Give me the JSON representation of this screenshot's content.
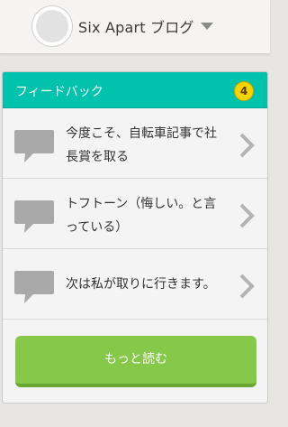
{
  "header": {
    "blog_name": "Six Apart ブログ"
  },
  "feedback": {
    "title": "フィードバック",
    "count": "4",
    "items": [
      {
        "text": "今度こそ、自転車記事で社長賞を取る"
      },
      {
        "text": "トフトーン（悔しい。と言っている）"
      },
      {
        "text": "次は私が取りに行きます。"
      }
    ],
    "more_label": "もっと読む"
  },
  "colors": {
    "accent": "#00c2ad",
    "badge": "#f7d300",
    "button": "#86c94a"
  }
}
